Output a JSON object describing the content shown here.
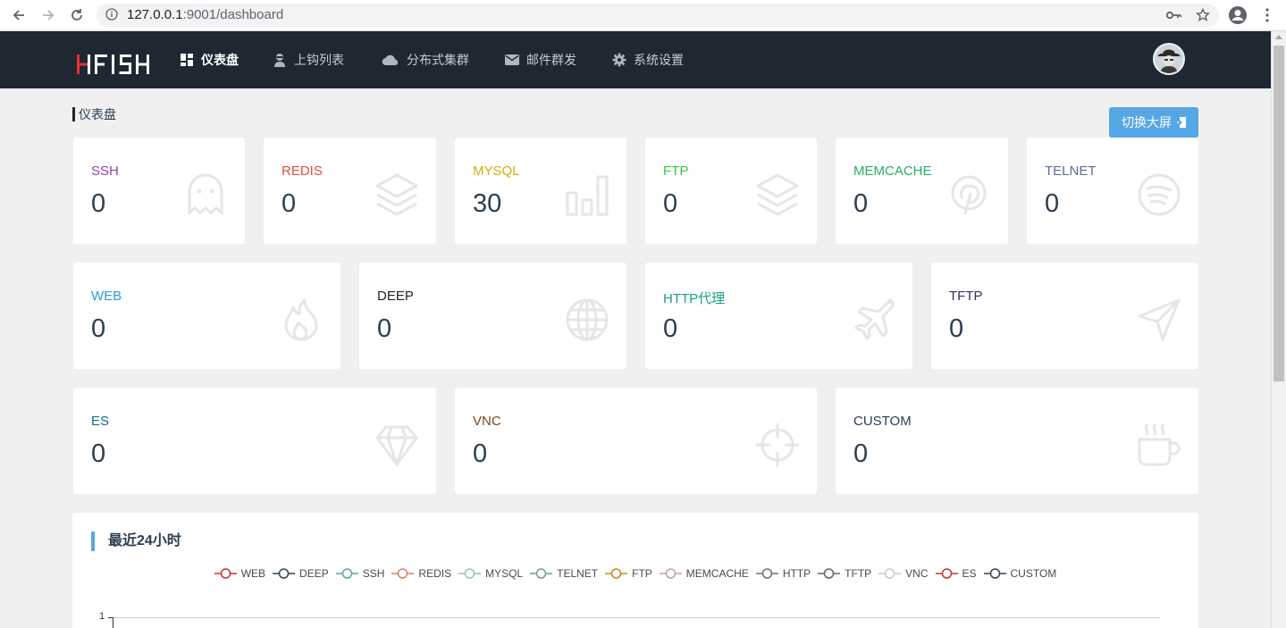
{
  "browser": {
    "url_host": "127.0.0.1",
    "url_rest": ":9001/dashboard"
  },
  "app": {
    "logo": "HFISH",
    "nav": [
      {
        "label": "仪表盘",
        "icon": "dashboard-icon",
        "active": true
      },
      {
        "label": "上钩列表",
        "icon": "hacker-icon",
        "active": false
      },
      {
        "label": "分布式集群",
        "icon": "cloud-icon",
        "active": false
      },
      {
        "label": "邮件群发",
        "icon": "envelope-icon",
        "active": false
      },
      {
        "label": "系统设置",
        "icon": "gear-icon",
        "active": false
      }
    ]
  },
  "page": {
    "title": "仪表盘",
    "switch_button": "切换大屏"
  },
  "cards": [
    {
      "label": "SSH",
      "value": "0",
      "color": "#8e44ad",
      "icon": "ghost-icon"
    },
    {
      "label": "REDIS",
      "value": "0",
      "color": "#e74c3c",
      "icon": "layers-icon"
    },
    {
      "label": "MYSQL",
      "value": "30",
      "color": "#d4ac0d",
      "icon": "bar-chart-icon"
    },
    {
      "label": "FTP",
      "value": "0",
      "color": "#2ecc40",
      "icon": "layers-icon"
    },
    {
      "label": "MEMCACHE",
      "value": "0",
      "color": "#27ae60",
      "icon": "pinterest-icon"
    },
    {
      "label": "TELNET",
      "value": "0",
      "color": "#5d6d9e",
      "icon": "spotify-icon"
    },
    {
      "label": "WEB",
      "value": "0",
      "color": "#3498db",
      "icon": "fire-icon"
    },
    {
      "label": "DEEP",
      "value": "0",
      "color": "#222222",
      "icon": "globe-icon"
    },
    {
      "label": "HTTP代理",
      "value": "0",
      "color": "#16a085",
      "icon": "plane-icon"
    },
    {
      "label": "TFTP",
      "value": "0",
      "color": "#34305e",
      "icon": "send-icon"
    },
    {
      "label": "ES",
      "value": "0",
      "color": "#1a6b8a",
      "icon": "diamond-icon"
    },
    {
      "label": "VNC",
      "value": "0",
      "color": "#7b4a1e",
      "icon": "crosshair-icon"
    },
    {
      "label": "CUSTOM",
      "value": "0",
      "color": "#2c3e50",
      "icon": "coffee-icon"
    }
  ],
  "chart": {
    "title": "最近24小时",
    "legend": [
      {
        "name": "WEB",
        "color": "#c23531"
      },
      {
        "name": "DEEP",
        "color": "#2f4554"
      },
      {
        "name": "SSH",
        "color": "#61a0a8"
      },
      {
        "name": "REDIS",
        "color": "#d48265"
      },
      {
        "name": "MYSQL",
        "color": "#91c7ae"
      },
      {
        "name": "TELNET",
        "color": "#749f83"
      },
      {
        "name": "FTP",
        "color": "#ca8622"
      },
      {
        "name": "MEMCACHE",
        "color": "#bda29a"
      },
      {
        "name": "HTTP",
        "color": "#6e7074"
      },
      {
        "name": "TFTP",
        "color": "#546570"
      },
      {
        "name": "VNC",
        "color": "#c4ccd3"
      },
      {
        "name": "ES",
        "color": "#c23531"
      },
      {
        "name": "CUSTOM",
        "color": "#2f4554"
      }
    ],
    "y_tick": "1"
  }
}
